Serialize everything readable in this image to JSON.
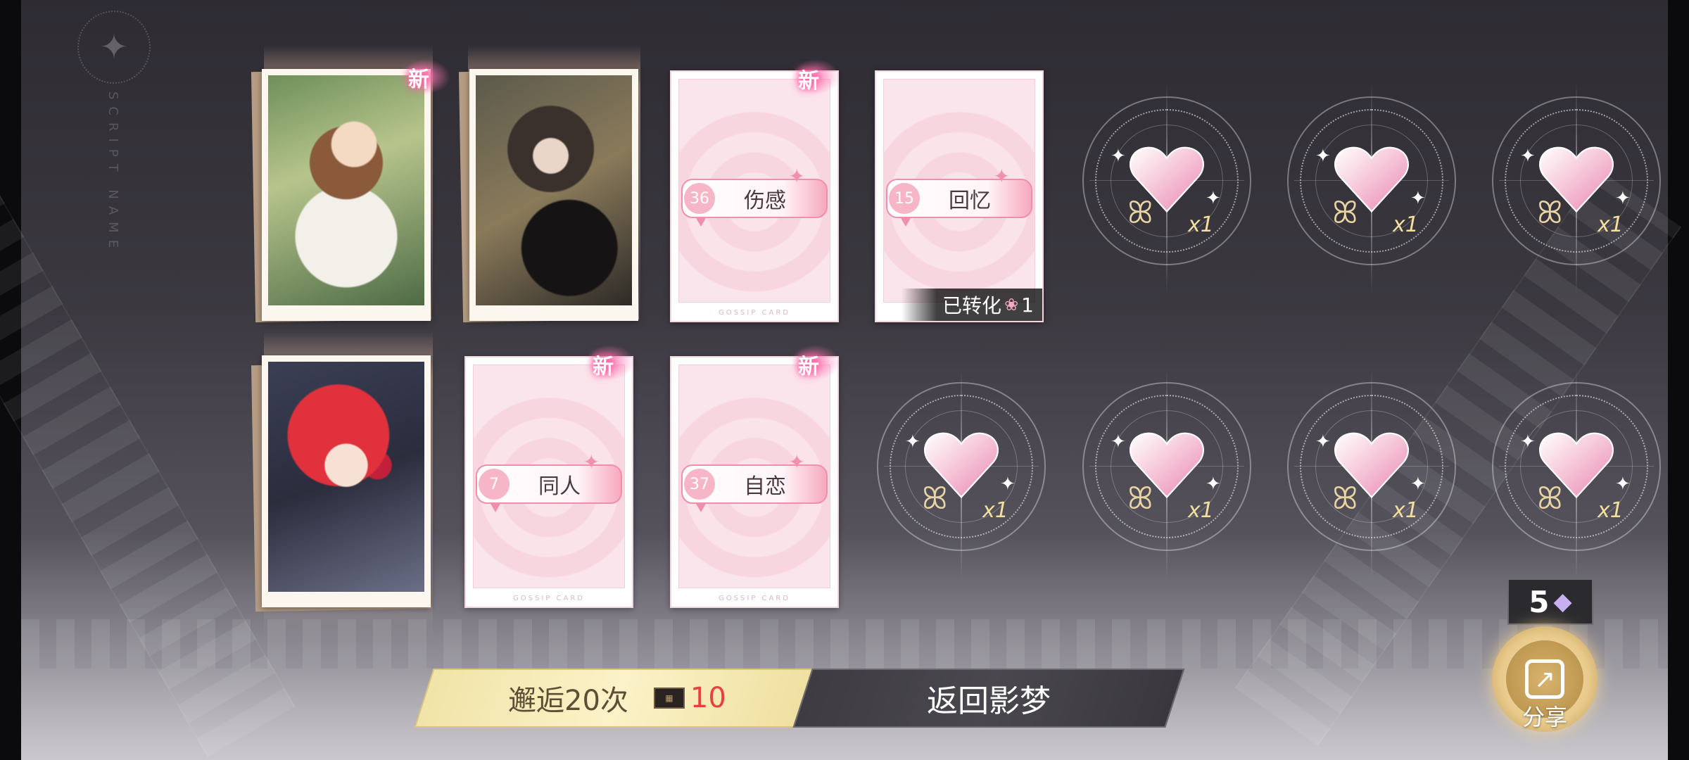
{
  "header": {
    "logo_icon": "sparkle-icon",
    "logo_text": "SCRIPT NAME"
  },
  "badges": {
    "new": "新"
  },
  "cards": [
    {
      "kind": "photo",
      "art": "girl-in-white-dress",
      "is_new": true
    },
    {
      "kind": "photo",
      "art": "dark-haired-chibi",
      "is_new": false
    },
    {
      "kind": "gossip",
      "number": "36",
      "label": "伤感",
      "is_new": true
    },
    {
      "kind": "gossip",
      "number": "15",
      "label": "回忆",
      "is_new": true,
      "converted_text": "已转化",
      "converted_qty": "1"
    },
    {
      "kind": "photo",
      "art": "red-haired-chibi",
      "is_new": false
    },
    {
      "kind": "gossip",
      "number": "7",
      "label": "同人",
      "is_new": true
    },
    {
      "kind": "gossip",
      "number": "37",
      "label": "自恋",
      "is_new": true
    }
  ],
  "gossip_footer": "GOSSIP CARD",
  "reward_items": {
    "icon": "crystal-heart-icon",
    "qty": "x1",
    "count": 7
  },
  "actions": {
    "draw_label": "邂逅20次",
    "draw_cost": "10",
    "return_label": "返回影梦"
  },
  "share": {
    "count": "5",
    "label": "分享"
  },
  "colors": {
    "accent_pink": "#f08fac",
    "gold": "#f1e4a8",
    "cost_red": "#e64040"
  }
}
